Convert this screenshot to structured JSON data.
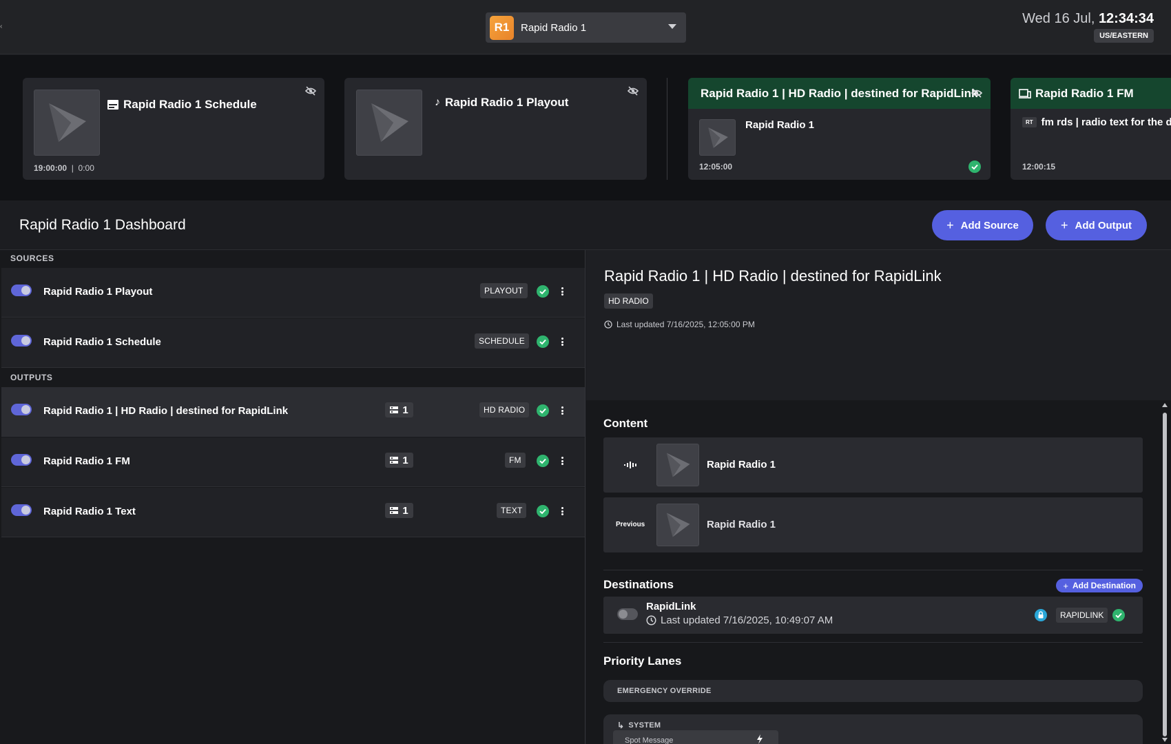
{
  "header": {
    "station_badge": "R1",
    "station_name": "Rapid Radio 1",
    "clock_date": "Wed 16 Jul,",
    "clock_time": "12:34:34",
    "timezone": "US/EASTERN"
  },
  "previews": {
    "sources": [
      {
        "title": "Rapid Radio 1 Schedule",
        "icon": "schedule-icon",
        "time": "19:00:00",
        "separator": "|",
        "duration": "0:00"
      },
      {
        "title": "Rapid Radio 1 Playout",
        "icon": "music-note-icon"
      }
    ],
    "outputs": [
      {
        "title": "Rapid Radio 1 | HD Radio | destined for RapidLink",
        "icon": "output-device-icon",
        "now_playing": "Rapid Radio 1",
        "time": "12:05:00"
      },
      {
        "title": "Rapid Radio 1 FM",
        "icon": "output-device-icon",
        "rt_badge": "RT",
        "text": "fm rds | radio text for the day",
        "time": "12:00:15"
      }
    ]
  },
  "dashboard": {
    "title": "Rapid Radio 1 Dashboard",
    "add_source": "Add Source",
    "add_output": "Add Output",
    "plus": "+"
  },
  "sources": {
    "label": "SOURCES",
    "items": [
      {
        "name": "Rapid Radio 1 Playout",
        "tag": "PLAYOUT"
      },
      {
        "name": "Rapid Radio 1 Schedule",
        "tag": "SCHEDULE"
      }
    ]
  },
  "outputs": {
    "label": "OUTPUTS",
    "items": [
      {
        "name": "Rapid Radio 1 | HD Radio | destined for RapidLink",
        "count": "1",
        "tag": "HD RADIO"
      },
      {
        "name": "Rapid Radio 1 FM",
        "count": "1",
        "tag": "FM"
      },
      {
        "name": "Rapid Radio 1 Text",
        "count": "1",
        "tag": "TEXT"
      }
    ]
  },
  "detail": {
    "title": "Rapid Radio 1 | HD Radio | destined for RapidLink",
    "tag": "HD RADIO",
    "last_updated": "Last updated 7/16/2025, 12:05:00 PM",
    "content_heading": "Content",
    "current_name": "Rapid Radio 1",
    "previous_label": "Previous",
    "previous_name": "Rapid Radio 1",
    "destinations_heading": "Destinations",
    "add_destination": "Add Destination",
    "destination": {
      "name": "RapidLink",
      "last_updated": "Last updated 7/16/2025, 10:49:07 AM",
      "tag": "RAPIDLINK"
    },
    "priority_heading": "Priority Lanes",
    "emergency_label": "EMERGENCY OVERRIDE",
    "system_label": "SYSTEM",
    "spot_label": "Spot Message"
  },
  "colors": {
    "accent": "#5560e0",
    "success": "#2fb46e",
    "output_header": "#15462e",
    "badge": "#f0962f",
    "lock": "#2aa7d8"
  }
}
